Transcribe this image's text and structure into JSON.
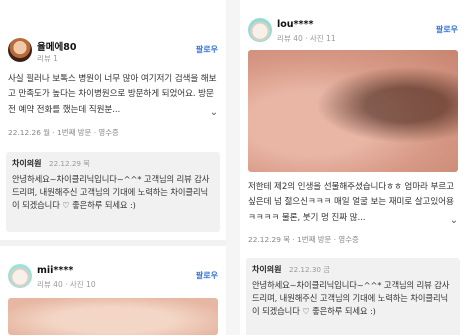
{
  "left": {
    "review1": {
      "nickname": "율메에80",
      "meta": "리뷰 1",
      "follow_label": "팔로우",
      "text": "사실 필러나 보톡스 병원이 너무 많아 여기저기 검색을 해보고 만족도가 높다는 차이병원으로 방문하게 되었어요. 방문전 예약 전화를 했는데 직원분...",
      "more_icon": "chevron-down-icon",
      "date_line": "22.12.26 월 · 1번째 방문 · 영수증",
      "reply": {
        "name": "차이의원",
        "date": "22.12.29 목",
        "text": "안녕하세요~차이클리닉입니다~^^* 고객님의 리뷰 감사드리며, 내원해주신 고객님의 기대에 노력하는 차이클리닉이 되겠습니다 ♡ 좋은하루 되세요 :)"
      }
    },
    "review2": {
      "nickname": "mii****",
      "meta": "리뷰 40 · 사진 10",
      "follow_label": "팔로우"
    }
  },
  "right": {
    "review1": {
      "nickname": "lou****",
      "meta": "리뷰 40 · 사진 11",
      "follow_label": "팔로우",
      "text": "저한테 제2의 인생을 선물해주셨습니다ㅎㅎ 엄마라 부르고싶은데 넘 젊으신ㅋㅋㅋ 매일 얼굴 보는 재미로 살고있어용ㅋㅋㅋㅋ 물론, 붓기 멍 진짜 많...",
      "more_icon": "chevron-down-icon",
      "date_line": "22.12.29 목 · 1번째 방문 · 영수증",
      "reply": {
        "name": "차이의원",
        "date": "22.12.30 금",
        "text": "안녕하세요~차이클리닉입니다~^^* 고객님의 리뷰 감사드리며, 내원해주신 고객님의 기대에 노력하는 차이클리닉이 되겠습니다 ♡ 좋은하루 되세요 :)"
      }
    }
  }
}
